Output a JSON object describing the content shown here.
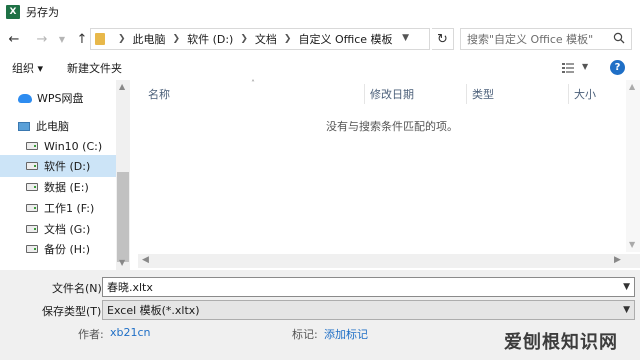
{
  "window": {
    "title": "另存为",
    "app_icon_letter": "X"
  },
  "nav": {
    "back_icon": "back-arrow-icon",
    "forward_icon": "forward-arrow-icon",
    "up_icon": "up-arrow-icon",
    "breadcrumb": [
      "此电脑",
      "软件 (D:)",
      "文档",
      "自定义 Office 模板"
    ],
    "search_placeholder": "搜索\"自定义 Office 模板\""
  },
  "toolbar": {
    "organize_label": "组织 ▾",
    "new_folder_label": "新建文件夹"
  },
  "sidebar": {
    "items": [
      {
        "label": "WPS网盘",
        "icon": "cloud-icon"
      },
      {
        "label": "此电脑",
        "icon": "computer-icon"
      },
      {
        "label": "Win10 (C:)",
        "icon": "drive-icon"
      },
      {
        "label": "软件 (D:)",
        "icon": "drive-icon",
        "selected": true
      },
      {
        "label": "数据 (E:)",
        "icon": "drive-icon"
      },
      {
        "label": "工作1 (F:)",
        "icon": "drive-icon"
      },
      {
        "label": "文档 (G:)",
        "icon": "drive-icon"
      },
      {
        "label": "备份 (H:)",
        "icon": "drive-icon"
      }
    ]
  },
  "filelist": {
    "columns": [
      "名称",
      "修改日期",
      "类型",
      "大小"
    ],
    "empty_message": "没有与搜索条件匹配的项。"
  },
  "form": {
    "filename_label": "文件名(N):",
    "filename_value": "春晓.xltx",
    "filetype_label": "保存类型(T):",
    "filetype_value": "Excel 模板(*.xltx)",
    "author_label": "作者:",
    "author_value": "xb21cn",
    "tags_label": "标记:",
    "tags_value": "添加标记"
  },
  "watermark": "爱刨根知识网",
  "colors": {
    "selected_bg": "#cce4f7",
    "link": "#1f6fc6",
    "help": "#1f6fc6",
    "excel_green": "#1e7145"
  }
}
